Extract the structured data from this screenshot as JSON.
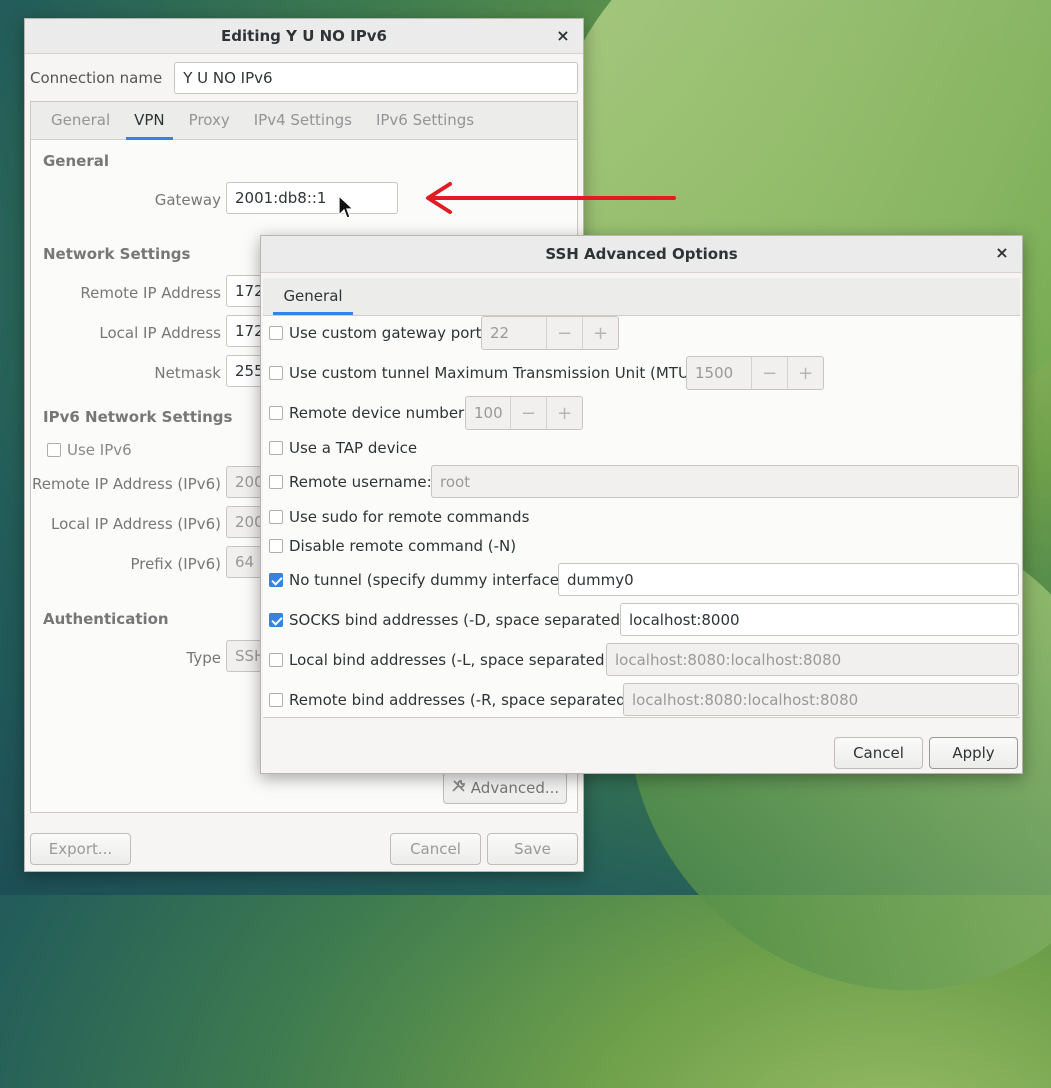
{
  "main_window": {
    "title": "Editing Y U NO IPv6",
    "connection_name_label": "Connection name",
    "connection_name_value": "Y U NO IPv6",
    "tabs": [
      "General",
      "VPN",
      "Proxy",
      "IPv4 Settings",
      "IPv6 Settings"
    ],
    "active_tab": "VPN",
    "general_section": "General",
    "gateway_label": "Gateway",
    "gateway_value": "2001:db8::1",
    "network_section": "Network Settings",
    "remote_ip_label": "Remote IP Address",
    "remote_ip_value": "172.",
    "local_ip_label": "Local IP Address",
    "local_ip_value": "172.",
    "netmask_label": "Netmask",
    "netmask_value": "255",
    "ipv6_section": "IPv6 Network Settings",
    "use_ipv6_label": "Use IPv6",
    "remote_ipv6_label": "Remote IP Address (IPv6)",
    "remote_ipv6_value": "200",
    "local_ipv6_label": "Local IP Address (IPv6)",
    "local_ipv6_value": "200",
    "prefix_label": "Prefix (IPv6)",
    "prefix_value": "64",
    "auth_section": "Authentication",
    "type_label": "Type",
    "type_value": "SSH",
    "advanced_label": "Advanced...",
    "export_label": "Export...",
    "cancel_label": "Cancel",
    "save_label": "Save"
  },
  "ssh_dialog": {
    "title": "SSH Advanced Options",
    "tab": "General",
    "options": {
      "gateway_port": {
        "label": "Use custom gateway port:",
        "checked": false,
        "value": "22"
      },
      "mtu": {
        "label": "Use custom tunnel Maximum Transmission Unit (MTU):",
        "checked": false,
        "value": "1500"
      },
      "device_number": {
        "label": "Remote device number:",
        "checked": false,
        "value": "100"
      },
      "tap": {
        "label": "Use a TAP device",
        "checked": false
      },
      "username": {
        "label": "Remote username:",
        "checked": false,
        "value": "root"
      },
      "sudo": {
        "label": "Use sudo for remote commands",
        "checked": false
      },
      "no_command": {
        "label": "Disable remote command (-N)",
        "checked": false
      },
      "no_tunnel": {
        "label": "No tunnel (specify dummy interface):",
        "checked": true,
        "value": "dummy0"
      },
      "socks": {
        "label": "SOCKS bind addresses (-D, space separated):",
        "checked": true,
        "value": "localhost:8000"
      },
      "local_bind": {
        "label": "Local bind addresses (-L, space separated):",
        "checked": false,
        "value": "localhost:8080:localhost:8080"
      },
      "remote_bind": {
        "label": "Remote bind addresses (-R, space separated):",
        "checked": false,
        "value": "localhost:8080:localhost:8080"
      }
    },
    "minus": "−",
    "plus": "+",
    "cancel_label": "Cancel",
    "apply_label": "Apply"
  },
  "close_glyph": "×",
  "colors": {
    "accent": "#3584e4",
    "arrow": "#e01b24"
  }
}
